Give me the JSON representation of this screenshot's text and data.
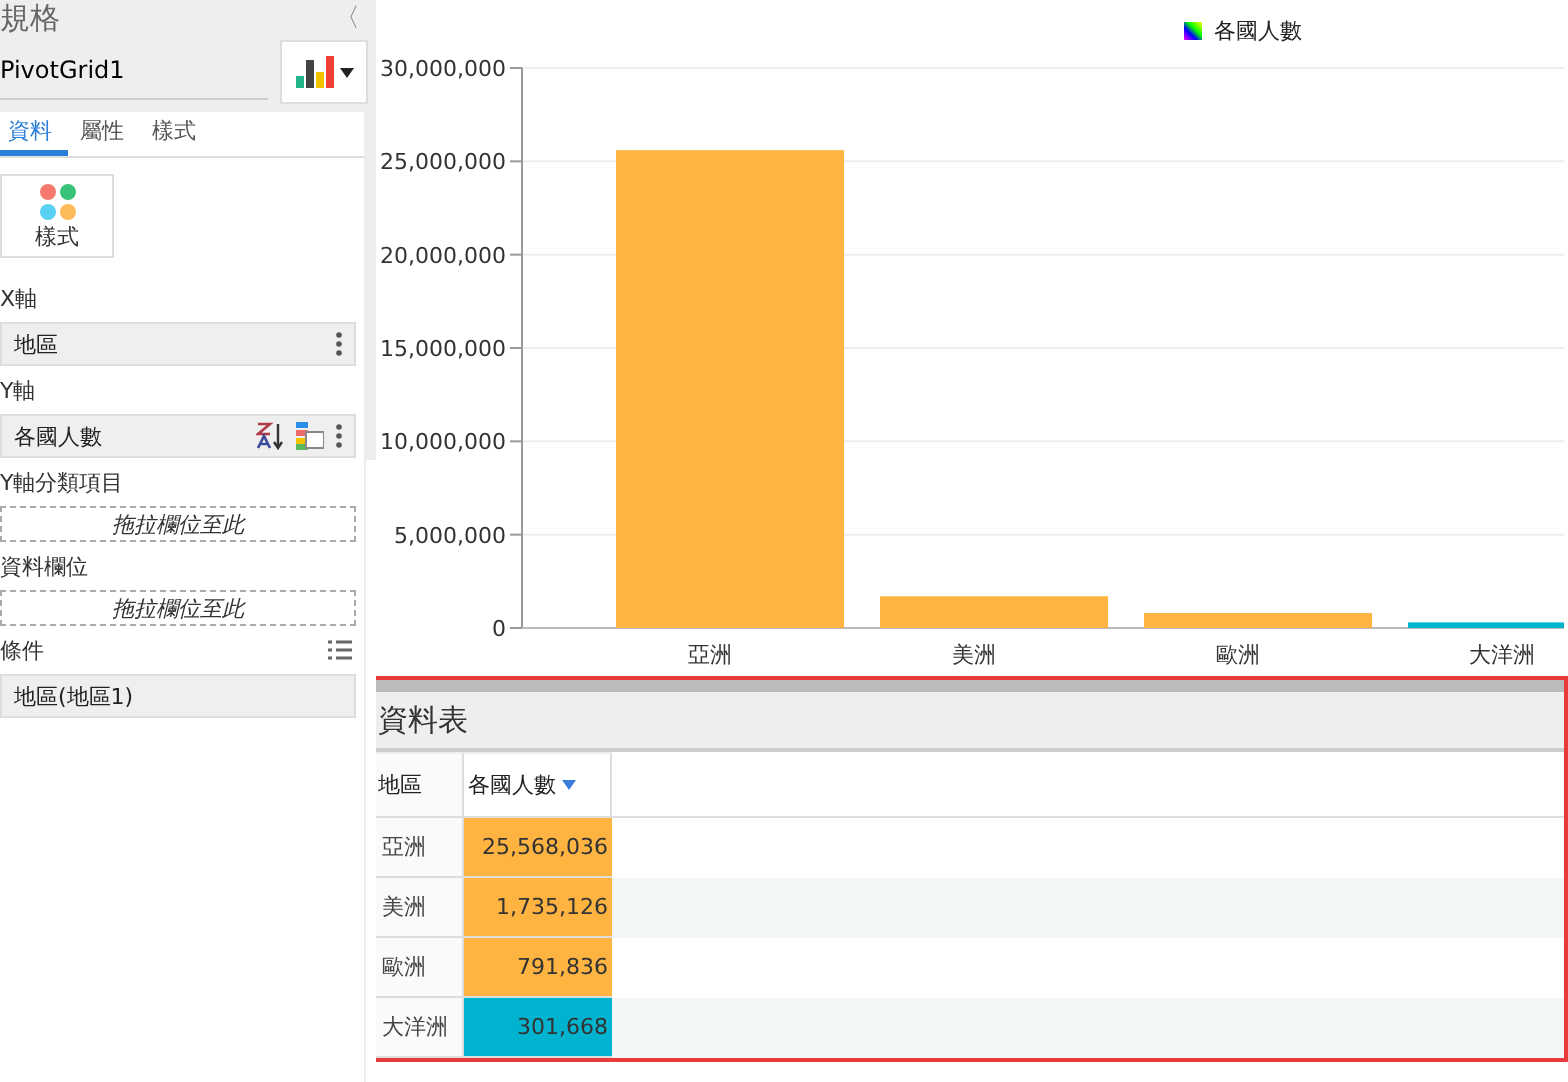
{
  "panel": {
    "title": "規格",
    "collapse": "〈",
    "name": "PivotGrid1",
    "tabs": [
      {
        "label": "資料",
        "selected": true
      },
      {
        "label": "屬性",
        "selected": false
      },
      {
        "label": "樣式",
        "selected": false
      }
    ],
    "style_button": "樣式",
    "sections": [
      {
        "kind": "field",
        "label": "X軸",
        "value": "地區",
        "sort": false
      },
      {
        "kind": "field",
        "label": "Y軸",
        "value": "各國人數",
        "sort": true
      },
      {
        "kind": "drop",
        "label": "Y軸分類項目",
        "placeholder": "拖拉欄位至此"
      },
      {
        "kind": "drop",
        "label": "資料欄位",
        "placeholder": "拖拉欄位至此"
      },
      {
        "kind": "filter",
        "label": "條件",
        "value": "地區(地區1)"
      }
    ]
  },
  "chart": {
    "chart_data": {
      "type": "bar",
      "grid": true,
      "categories": [
        "亞洲",
        "美洲",
        "歐洲",
        "大洋洲"
      ],
      "series": [
        {
          "name": "各國人數",
          "values": [
            25600000,
            1700000,
            800000,
            300000
          ]
        }
      ],
      "ylim": [
        0,
        30000000
      ],
      "yticks": [
        {
          "value": 0,
          "label": "0"
        },
        {
          "value": 5000000,
          "label": "5,000,000"
        },
        {
          "value": 10000000,
          "label": "10,000,000"
        },
        {
          "value": 15000000,
          "label": "15,000,000"
        },
        {
          "value": 20000000,
          "label": "20,000,000"
        },
        {
          "value": 25000000,
          "label": "25,000,000"
        },
        {
          "value": 30000000,
          "label": "30,000,000"
        }
      ]
    }
  },
  "table": {
    "title": "資料表",
    "columns": [
      "地區",
      "各國人數"
    ],
    "rows": [
      {
        "region": "亞洲",
        "value": "25,568,036",
        "color": "#ffb341"
      },
      {
        "region": "美洲",
        "value": "1,735,126",
        "color": "#ffb341"
      },
      {
        "region": "歐洲",
        "value": "791,836",
        "color": "#ffb341"
      },
      {
        "region": "大洋洲",
        "value": "301,668",
        "color": "#00b4d0"
      }
    ]
  }
}
